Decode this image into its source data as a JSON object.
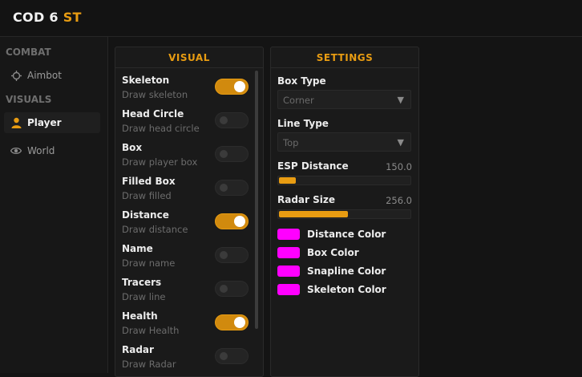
{
  "app": {
    "title_main": "COD 6",
    "title_accent": "ST",
    "accent_color": "#e89c12"
  },
  "sidebar": {
    "sections": [
      {
        "label": "COMBAT",
        "items": [
          {
            "label": "Aimbot",
            "icon": "crosshair-icon"
          }
        ]
      },
      {
        "label": "VISUALS",
        "items": [
          {
            "label": "Player",
            "icon": "user-icon",
            "active": true
          },
          {
            "label": "World",
            "icon": "eye-icon"
          }
        ]
      }
    ]
  },
  "visual": {
    "title": "VISUAL",
    "rows": [
      {
        "title": "Skeleton",
        "desc": "Draw skeleton",
        "on": true
      },
      {
        "title": "Head Circle",
        "desc": "Draw head circle",
        "on": false
      },
      {
        "title": "Box",
        "desc": "Draw player box",
        "on": false
      },
      {
        "title": "Filled Box",
        "desc": "Draw filled",
        "on": false
      },
      {
        "title": "Distance",
        "desc": "Draw distance",
        "on": true
      },
      {
        "title": "Name",
        "desc": "Draw name",
        "on": false
      },
      {
        "title": "Tracers",
        "desc": "Draw line",
        "on": false
      },
      {
        "title": "Health",
        "desc": "Draw Health",
        "on": true
      },
      {
        "title": "Radar",
        "desc": "Draw Radar",
        "on": false
      }
    ]
  },
  "settings": {
    "title": "SETTINGS",
    "box_type": {
      "label": "Box Type",
      "value": "Corner"
    },
    "line_type": {
      "label": "Line Type",
      "value": "Top"
    },
    "esp_distance": {
      "label": "ESP Distance",
      "value": "150.0",
      "fraction": 0.13
    },
    "radar_size": {
      "label": "Radar Size",
      "value": "256.0",
      "fraction": 0.53
    },
    "colors": [
      {
        "label": "Distance Color",
        "color": "#ff00ff"
      },
      {
        "label": "Box Color",
        "color": "#ff00ff"
      },
      {
        "label": "Snapline Color",
        "color": "#ff00ff"
      },
      {
        "label": "Skeleton Color",
        "color": "#ff00ff"
      }
    ]
  }
}
